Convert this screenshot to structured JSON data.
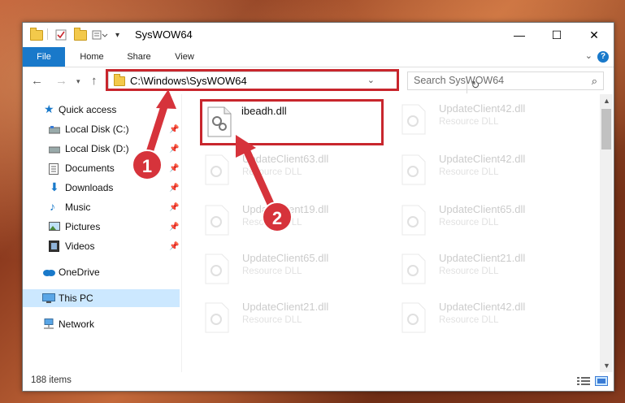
{
  "window": {
    "title": "SysWOW64",
    "minimize_glyph": "—",
    "maximize_glyph": "☐",
    "close_glyph": "✕"
  },
  "ribbon": {
    "tabs": [
      "File",
      "Home",
      "Share",
      "View"
    ],
    "help_glyph": "?",
    "expand_glyph": "⌄"
  },
  "address": {
    "path": "C:\\Windows\\SysWOW64",
    "search_placeholder": "Search SysWOW64"
  },
  "sidebar": {
    "items": [
      {
        "label": "Quick access",
        "icon": "star-icon",
        "pinned": false
      },
      {
        "label": "Local Disk (C:)",
        "icon": "drive-icon",
        "pinned": true
      },
      {
        "label": "Local Disk (D:)",
        "icon": "drive-icon",
        "pinned": true
      },
      {
        "label": "Documents",
        "icon": "documents-icon",
        "pinned": true
      },
      {
        "label": "Downloads",
        "icon": "download-icon",
        "pinned": true
      },
      {
        "label": "Music",
        "icon": "music-icon",
        "pinned": true
      },
      {
        "label": "Pictures",
        "icon": "pictures-icon",
        "pinned": true
      },
      {
        "label": "Videos",
        "icon": "videos-icon",
        "pinned": true
      },
      {
        "label": "OneDrive",
        "icon": "cloud-icon",
        "pinned": false
      },
      {
        "label": "This PC",
        "icon": "computer-icon",
        "pinned": false,
        "selected": true
      },
      {
        "label": "Network",
        "icon": "network-icon",
        "pinned": false
      }
    ]
  },
  "files": [
    {
      "name": "ibeadh.dll",
      "type": "",
      "highlighted": true
    },
    {
      "name": "UpdateClient42.dll",
      "type": "Resource DLL"
    },
    {
      "name": "UpdateClient63.dll",
      "type": "Resource DLL"
    },
    {
      "name": "UpdateClient42.dll",
      "type": "Resource DLL"
    },
    {
      "name": "UpdateClient19.dll",
      "type": "Resource DLL"
    },
    {
      "name": "UpdateClient65.dll",
      "type": "Resource DLL"
    },
    {
      "name": "UpdateClient65.dll",
      "type": "Resource DLL"
    },
    {
      "name": "UpdateClient21.dll",
      "type": "Resource DLL"
    },
    {
      "name": "UpdateClient21.dll",
      "type": "Resource DLL"
    },
    {
      "name": "UpdateClient42.dll",
      "type": "Resource DLL"
    }
  ],
  "status": {
    "item_count": "188 items"
  },
  "callouts": [
    "1",
    "2"
  ],
  "colors": {
    "accent": "#1979ca",
    "highlight_red": "#c8262d",
    "selected_bg": "#cce8ff"
  }
}
